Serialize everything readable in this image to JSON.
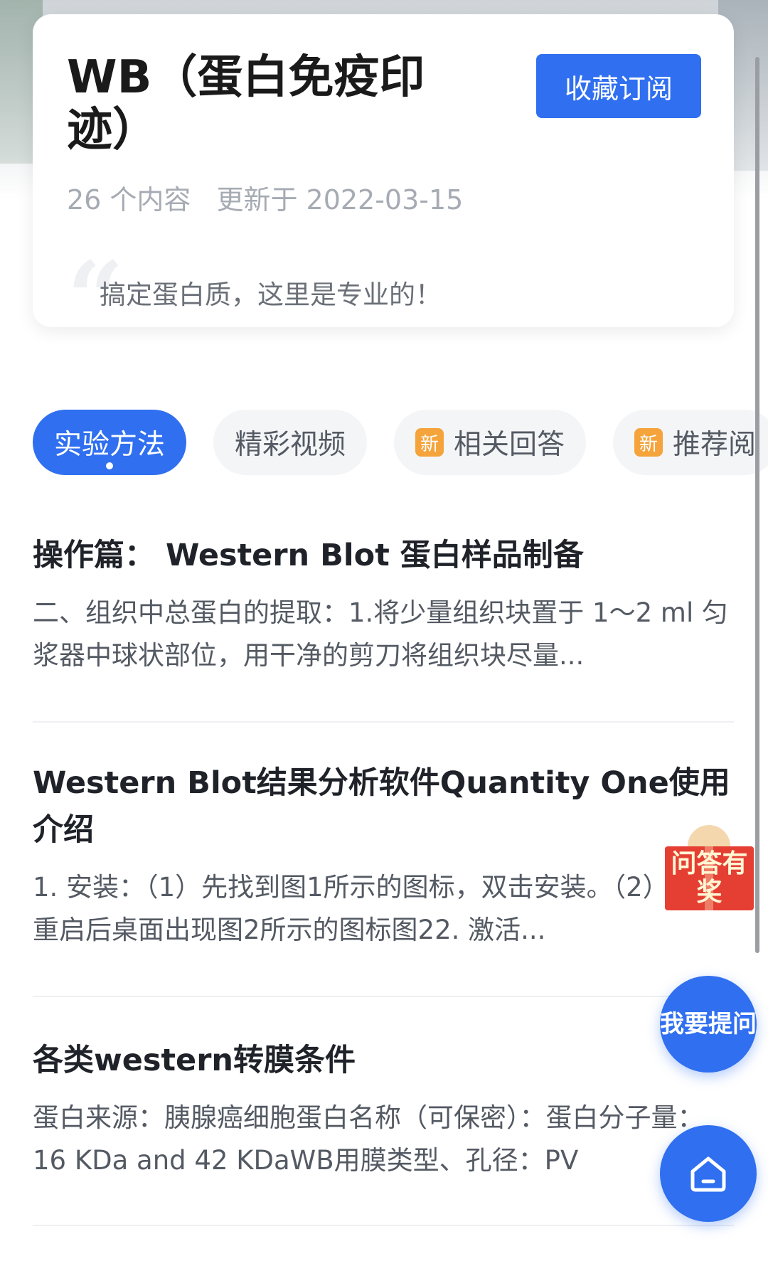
{
  "header": {
    "title": "WB（蛋白免疫印迹）",
    "subscribe_label": "收藏订阅",
    "content_count": "26 个内容",
    "updated": "更新于 2022-03-15",
    "quote": "搞定蛋白质，这里是专业的！"
  },
  "tabs": [
    {
      "label": "实验方法",
      "active": true,
      "new": false
    },
    {
      "label": "精彩视频",
      "active": false,
      "new": false
    },
    {
      "label": "相关回答",
      "active": false,
      "new": true
    },
    {
      "label": "推荐阅",
      "active": false,
      "new": true
    }
  ],
  "new_badge": "新",
  "articles": [
    {
      "title": "操作篇：  Western Blot 蛋白样品制备",
      "snippet": "二、组织中总蛋白的提取：1.将少量组织块置于 1～2 ml 匀浆器中球状部位，用干净的剪刀将组织块尽量..."
    },
    {
      "title": "Western Blot结果分析软件Quantity One使用介绍",
      "snippet": "1. 安装：（1）先找到图1所示的图标，双击安装。（2）系统重启后桌面出现图2所示的图标图22. 激活..."
    },
    {
      "title": "各类western转膜条件",
      "snippet": "蛋白来源：胰腺癌细胞蛋白名称（可保密）：蛋白分子量：16 KDa and 42 KDaWB用膜类型、孔径：PV"
    }
  ],
  "floating": {
    "qa_gift": "问答有奖",
    "ask_label": "我要提问",
    "home_icon": "home-icon"
  },
  "colors": {
    "accent": "#2f6ff0",
    "badge": "#f5a33b",
    "gift": "#e53f33"
  }
}
